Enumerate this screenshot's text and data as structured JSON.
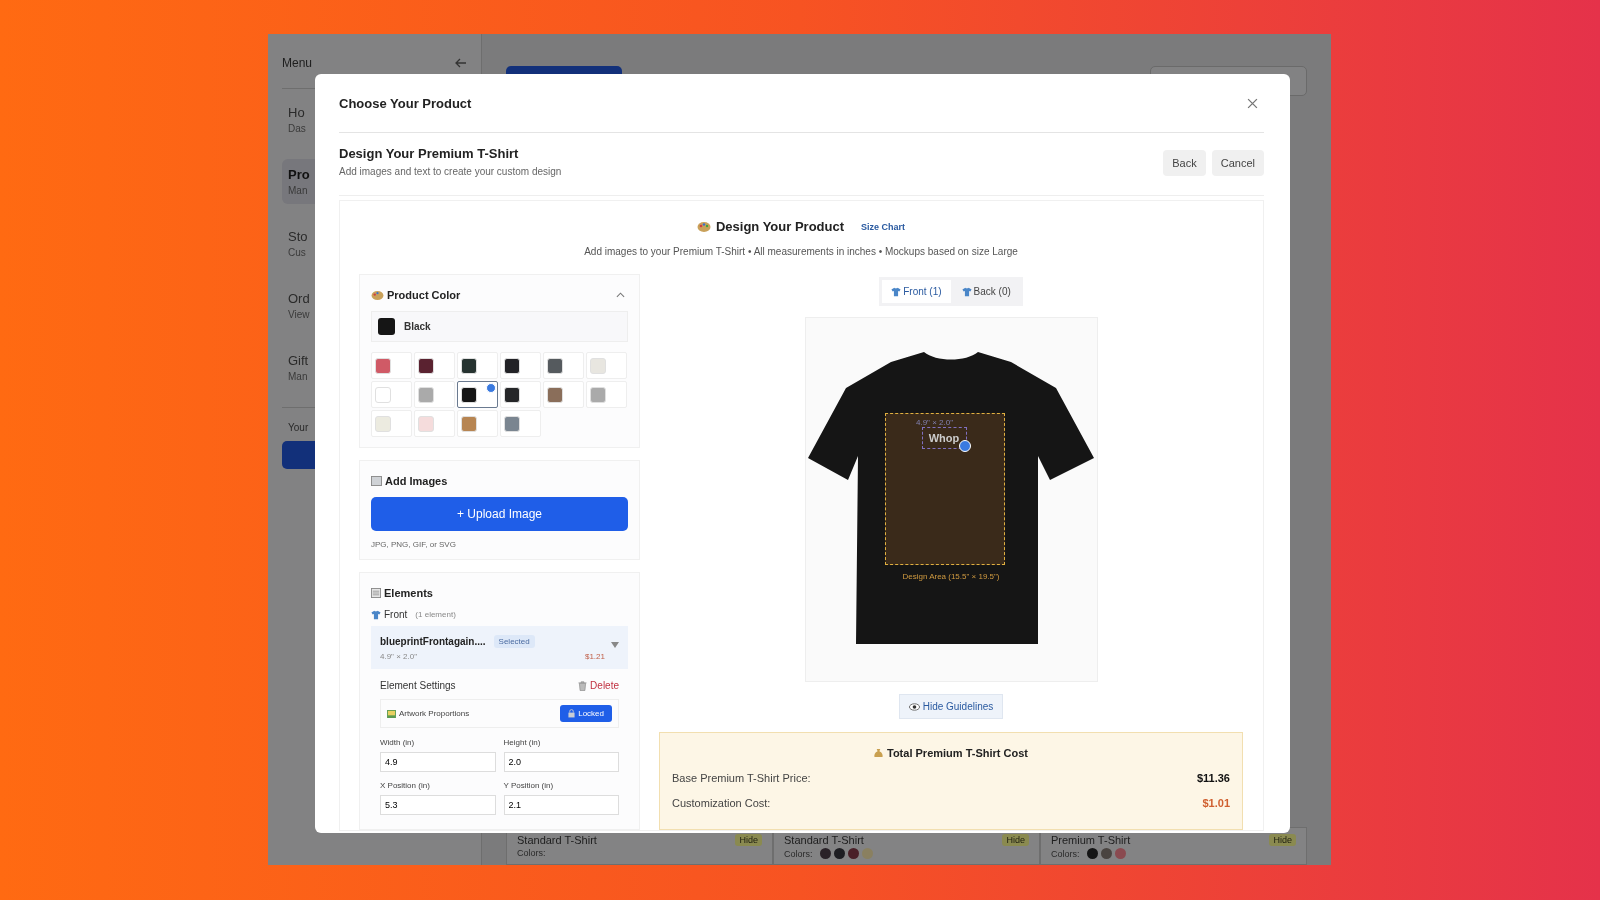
{
  "background_app": {
    "sidebar": {
      "title": "Menu",
      "items": [
        {
          "label": "Ho",
          "sublabel": "Das",
          "selected": false
        },
        {
          "label": "Pro",
          "sublabel": "Man",
          "selected": true
        },
        {
          "label": "Sto",
          "sublabel": "Cus",
          "selected": false
        },
        {
          "label": "Ord",
          "sublabel": "View",
          "selected": false
        },
        {
          "label": "Gift",
          "sublabel": "Man",
          "selected": false
        }
      ],
      "section_label": "Your"
    },
    "product_cards": [
      {
        "name": "Standard T-Shirt",
        "colors_label": "Colors:",
        "badge": "Hide"
      },
      {
        "name": "Standard T-Shirt",
        "colors_label": "Colors:",
        "badge": "Hide",
        "colors": [
          {
            "color": "#2a2228"
          },
          {
            "color": "#1e1e22"
          },
          {
            "color": "#4a2028"
          },
          {
            "color": "#8a8060"
          }
        ]
      },
      {
        "name": "Premium T-Shirt",
        "colors_label": "Colors:",
        "badge": "Hide",
        "colors": [
          {
            "color": "#151515"
          },
          {
            "color": "#4a4440"
          },
          {
            "color": "#8a4a50"
          }
        ]
      }
    ]
  },
  "modal": {
    "title": "Choose Your Product",
    "header": {
      "title": "Design Your Premium T-Shirt",
      "subtitle": "Add images and text to create your custom design",
      "buttons": [
        "Back",
        "Cancel"
      ]
    },
    "designer": {
      "title": "Design Your Product",
      "size_chart_link": "Size Chart",
      "subtitle": "Add images to your Premium T-Shirt • All measurements in inches • Mockups based on size Large",
      "product_color": {
        "title": "Product Color",
        "expanded": true,
        "selected_name": "Black",
        "swatches": [
          {
            "color": "#d05a66",
            "selected": false
          },
          {
            "color": "#5a2230",
            "selected": false
          },
          {
            "color": "#263330",
            "selected": false
          },
          {
            "color": "#222226",
            "selected": false
          },
          {
            "color": "#555a5e",
            "selected": false
          },
          {
            "color": "#e8e6e0",
            "selected": false
          },
          {
            "color": "#ffffff",
            "selected": false
          },
          {
            "color": "#aaaaaa",
            "selected": false
          },
          {
            "color": "#151515",
            "selected": true
          },
          {
            "color": "#252628",
            "selected": false
          },
          {
            "color": "#8a6e5a",
            "selected": false
          },
          {
            "color": "#aaaaaa",
            "selected": false
          },
          {
            "color": "#ecebe0",
            "selected": false
          },
          {
            "color": "#f5dcdc",
            "selected": false
          },
          {
            "color": "#b78552",
            "selected": false
          },
          {
            "color": "#7a8590",
            "selected": false
          }
        ]
      },
      "add_images": {
        "title": "Add Images",
        "button": "+ Upload Image",
        "hint": "JPG, PNG, GIF, or SVG"
      },
      "elements": {
        "title": "Elements",
        "side": "Front",
        "count": "(1 element)",
        "items": [
          {
            "name": "blueprintFrontagain....",
            "badge": "Selected",
            "selected": true,
            "size": "4.9\" × 2.0\"",
            "price": "$1.21"
          }
        ],
        "settings": {
          "title": "Element Settings",
          "delete": "Delete",
          "proportions_label": "Artwork Proportions",
          "lock_button": "Locked",
          "locked": true,
          "fields": [
            {
              "label": "Width (in)",
              "value": "4.9"
            },
            {
              "label": "Height (in)",
              "value": "2.0"
            },
            {
              "label": "X Position (in)",
              "value": "5.3"
            },
            {
              "label": "Y Position (in)",
              "value": "2.1"
            }
          ]
        }
      },
      "view_tabs": [
        {
          "label": "Front (1)",
          "selected": true
        },
        {
          "label": "Back (0)",
          "selected": false
        }
      ],
      "mockup": {
        "size_label": "4.9\" × 2.0\"",
        "artwork_text": "Whop",
        "design_area_label": "Design Area (15.5\" × 19.5\")"
      },
      "guidelines_button": "Hide Guidelines",
      "cost": {
        "title": "Total Premium T-Shirt Cost",
        "rows": [
          {
            "label": "Base Premium T-Shirt Price:",
            "value": "$11.36",
            "kind": "base"
          },
          {
            "label": "Customization Cost:",
            "value": "$1.01",
            "kind": "extra"
          }
        ]
      }
    }
  }
}
